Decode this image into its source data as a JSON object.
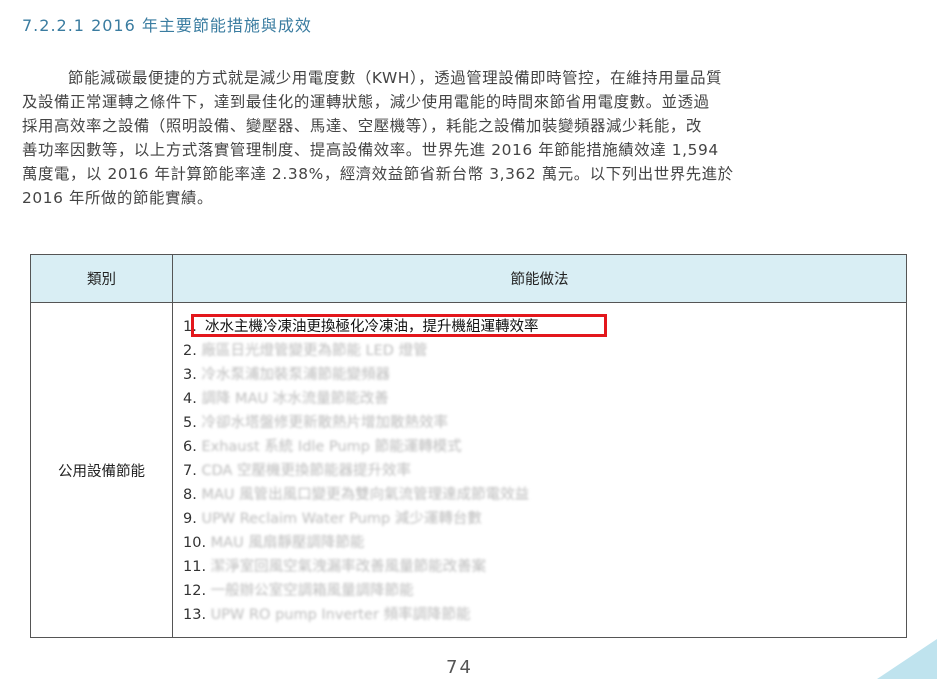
{
  "heading": "7.2.2.1 2016 年主要節能措施與成效",
  "paragraph_lines": [
    "節能減碳最便捷的方式就是減少用電度數（KWH），透過管理設備即時管控，在維持用量品質",
    "及設備正常運轉之條件下，達到最佳化的運轉狀態，減少使用電能的時間來節省用電度數。並透過",
    "採用高效率之設備（照明設備、變壓器、馬達、空壓機等），耗能之設備加裝變頻器減少耗能，改",
    "善功率因數等，以上方式落實管理制度、提高設備效率。世界先進 2016 年節能措施績效達 1,594",
    "萬度電，以 2016 年計算節能率達 2.38%，經濟效益節省新台幣 3,362 萬元。以下列出世界先進於",
    "2016 年所做的節能實績。"
  ],
  "table": {
    "headers": [
      "類別",
      "節能做法"
    ],
    "category": "公用設備節能",
    "items": [
      {
        "num": "1.",
        "text": "冰水主機冷凍油更換極化冷凍油，提升機組運轉效率"
      },
      {
        "num": "2.",
        "text": "廠區日光燈管變更為節能 LED 燈管"
      },
      {
        "num": "3.",
        "text": "冷水泵浦加裝泵浦節能變頻器"
      },
      {
        "num": "4.",
        "text": "調降 MAU 冰水流量節能改善"
      },
      {
        "num": "5.",
        "text": "冷卻水塔盤修更新散熱片增加散熱效率"
      },
      {
        "num": "6.",
        "text": "Exhaust 系統 Idle Pump 節能運轉模式"
      },
      {
        "num": "7.",
        "text": "CDA 空壓機更換節能器提升效率"
      },
      {
        "num": "8.",
        "text": "MAU 風管出風口變更為雙向氣流管理達成節電效益"
      },
      {
        "num": "9.",
        "text": "UPW Reclaim Water Pump 減少運轉台數"
      },
      {
        "num": "10.",
        "text": "MAU 風扇靜壓調降節能"
      },
      {
        "num": "11.",
        "text": "潔淨室回風空氣洩漏率改善風量節能改善案"
      },
      {
        "num": "12.",
        "text": "一般辦公室空調箱風量調降節能"
      },
      {
        "num": "13.",
        "text": "UPW RO pump Inverter 頻率調降節能"
      }
    ]
  },
  "page_number": "74",
  "colors": {
    "heading": "#3a7ca0",
    "table_header_bg": "#d9eef4",
    "highlight_border": "#e3171c",
    "corner_deco": "#bfe3ee"
  }
}
